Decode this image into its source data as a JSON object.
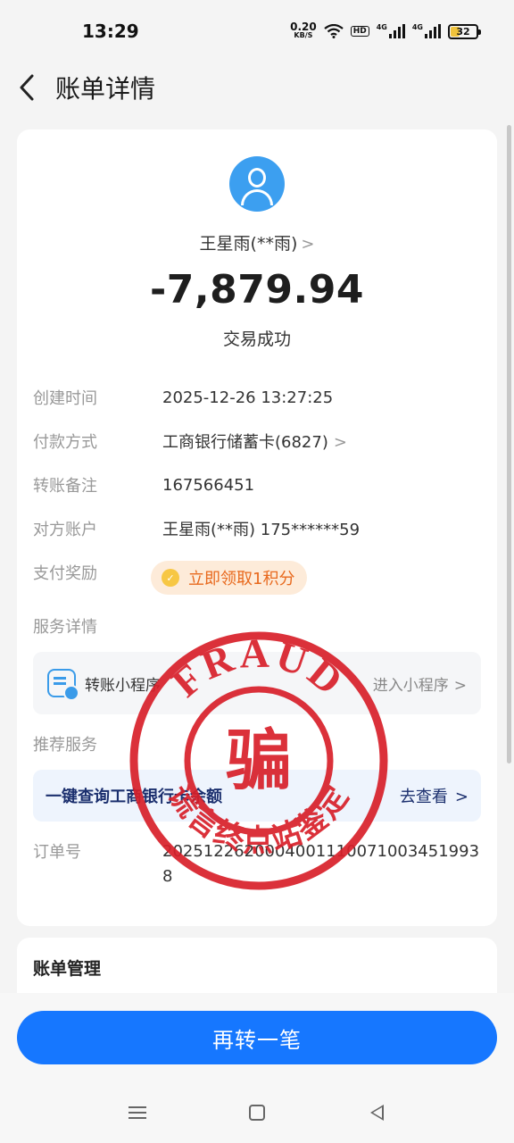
{
  "status_bar": {
    "time": "13:29",
    "net_speed_value": "0.20",
    "net_speed_unit": "KB/S",
    "hd_badge": "HD",
    "signal_1_gen": "4G",
    "signal_2_gen": "4G",
    "battery_level": "32",
    "battery_fraction": 0.32
  },
  "header": {
    "title": "账单详情"
  },
  "summary": {
    "payee": "王星雨(**雨)",
    "amount": "-7,879.94",
    "status": "交易成功"
  },
  "details": [
    {
      "label": "创建时间",
      "value": "2025-12-26 13:27:25"
    },
    {
      "label": "付款方式",
      "value": "工商银行储蓄卡(6827)"
    },
    {
      "label": "转账备注",
      "value": "167566451"
    },
    {
      "label": "对方账户",
      "value": "王星雨(**雨) 175******59"
    },
    {
      "label": "支付奖励",
      "value": ""
    }
  ],
  "reward": {
    "label": "立即领取1积分"
  },
  "service": {
    "section_label": "服务详情",
    "mini_program_label": "转账小程序",
    "mini_program_action": "进入小程序"
  },
  "recommend": {
    "section_label": "推荐服务",
    "query_label": "一键查询工商银行卡余额",
    "query_action": "去查看"
  },
  "order": {
    "label": "订单号",
    "value": "20251226200040011100710034519938"
  },
  "bill_management": {
    "title": "账单管理"
  },
  "actions": {
    "transfer_again": "再转一笔"
  },
  "stamp": {
    "top_text": "FRAUD",
    "center_char": "骗",
    "bottom_text": "谎言终点站鉴定",
    "color": "#d8202a"
  },
  "colors": {
    "primary_blue": "#1677ff",
    "reward_orange": "#e8691d"
  }
}
